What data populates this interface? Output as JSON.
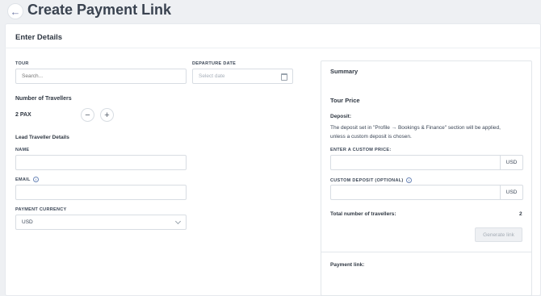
{
  "page": {
    "title": "Create Payment Link"
  },
  "card": {
    "header": "Enter Details"
  },
  "form": {
    "tour": {
      "label": "TOUR",
      "placeholder": "Search..."
    },
    "departure": {
      "label": "DEPARTURE DATE",
      "placeholder": "Select date"
    },
    "travellers": {
      "label": "Number of Travellers",
      "value": "2 PAX",
      "minus": "−",
      "plus": "+"
    },
    "lead": {
      "heading": "Lead Traveller Details"
    },
    "name": {
      "label": "NAME",
      "value": ""
    },
    "email": {
      "label": "EMAIL",
      "value": ""
    },
    "currency": {
      "label": "PAYMENT CURRENCY",
      "value": "USD"
    }
  },
  "summary": {
    "title": "Summary",
    "tour_price": "Tour Price",
    "deposit_label": "Deposit:",
    "deposit_note_1": "The deposit set in \"Profile → Bookings & Finance\" section will be applied,",
    "deposit_note_2": "unless a custom deposit is chosen.",
    "custom_price_label": "ENTER A CUSTOM PRICE:",
    "custom_price_currency": "USD",
    "custom_deposit_label": "CUSTOM DEPOSIT (OPTIONAL)",
    "custom_deposit_currency": "USD",
    "total_label": "Total number of travellers:",
    "total_value": "2",
    "generate_button": "Generate link",
    "payment_link_label": "Payment link:"
  },
  "icons": {
    "back": "arrow-left-icon",
    "calendar": "calendar-icon",
    "info": "info-icon",
    "chevron": "chevron-down-icon"
  }
}
